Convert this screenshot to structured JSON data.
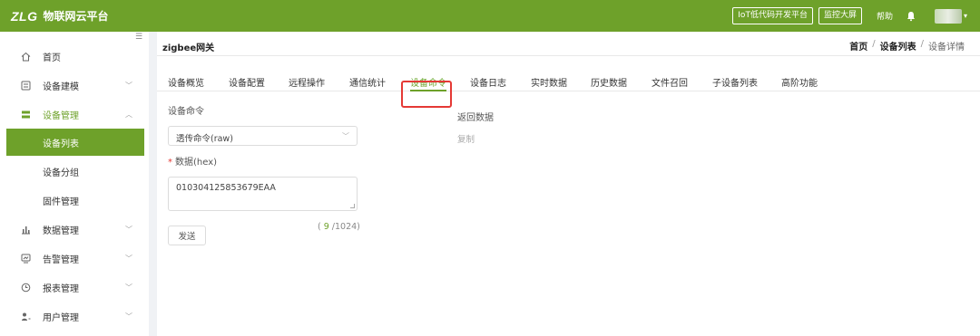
{
  "header": {
    "logo_mark": "ZLG",
    "logo_text": "物联网云平台",
    "lowcode_btn": "IoT低代码开发平台",
    "monitor_btn": "监控大屏",
    "help": "帮助",
    "brand_color": "#6ea12a"
  },
  "sidebar": {
    "items": [
      {
        "label": "首页",
        "icon": "home-icon"
      },
      {
        "label": "设备建模",
        "icon": "model-icon"
      },
      {
        "label": "设备管理",
        "icon": "device-icon"
      },
      {
        "label": "设备列表"
      },
      {
        "label": "设备分组"
      },
      {
        "label": "固件管理"
      },
      {
        "label": "数据管理",
        "icon": "chart-icon"
      },
      {
        "label": "告警管理",
        "icon": "alarm-icon"
      },
      {
        "label": "报表管理",
        "icon": "clock-icon"
      },
      {
        "label": "用户管理",
        "icon": "user-icon"
      }
    ]
  },
  "page": {
    "title": "zigbee网关",
    "breadcrumb": [
      "首页",
      "设备列表",
      "设备详情"
    ],
    "separator": "/"
  },
  "tabs": [
    "设备概览",
    "设备配置",
    "远程操作",
    "通信统计",
    "设备命令",
    "设备日志",
    "实时数据",
    "历史数据",
    "文件召回",
    "子设备列表",
    "高阶功能"
  ],
  "active_tab": "设备命令",
  "form": {
    "command_label": "设备命令",
    "command_value": "透传命令(raw)",
    "data_label": "数据(hex)",
    "data_value": "010304125853679EAA",
    "counter_open": "( ",
    "counter_current": "9",
    "counter_rest": " /1024)",
    "send_label": "发送"
  },
  "response": {
    "label": "返回数据",
    "copy_label": "复制"
  }
}
